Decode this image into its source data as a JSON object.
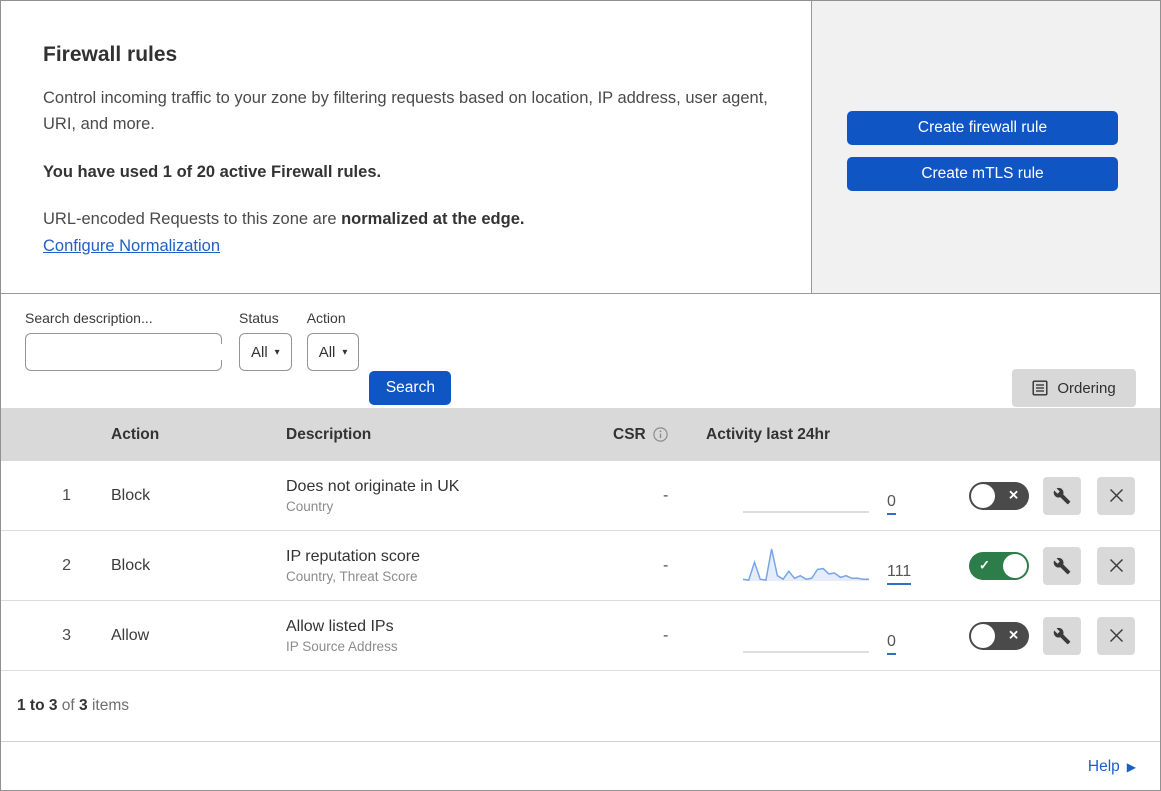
{
  "header": {
    "title": "Firewall rules",
    "description": "Control incoming traffic to your zone by filtering requests based on location, IP address, user agent, URI, and more.",
    "usage_note": "You have used 1 of 20 active Firewall rules.",
    "normalization_prefix": "URL-encoded Requests to this zone are ",
    "normalization_emphasis": "normalized at the edge.",
    "normalization_link": "Configure Normalization",
    "create_firewall_button": "Create firewall rule",
    "create_mtls_button": "Create mTLS rule"
  },
  "filters": {
    "search_label": "Search description...",
    "status": {
      "label": "Status",
      "value": "All"
    },
    "action": {
      "label": "Action",
      "value": "All"
    },
    "search_button": "Search",
    "ordering_button": "Ordering"
  },
  "table": {
    "headers": {
      "action": "Action",
      "description": "Description",
      "csr": "CSR",
      "activity": "Activity last 24hr"
    },
    "rows": [
      {
        "priority": "1",
        "action": "Block",
        "description": "Does not originate in UK",
        "parameters": "Country",
        "csr": "-",
        "activity_count": "0",
        "enabled": false,
        "sparkline": []
      },
      {
        "priority": "2",
        "action": "Block",
        "description": "IP reputation score",
        "parameters": "Country, Threat Score",
        "csr": "-",
        "activity_count": "111",
        "enabled": true,
        "sparkline": [
          2,
          1,
          21,
          2,
          1,
          36,
          6,
          2,
          11,
          3,
          6,
          2,
          3,
          13,
          14,
          8,
          9,
          4,
          6,
          3,
          3,
          2,
          2
        ]
      },
      {
        "priority": "3",
        "action": "Allow",
        "description": "Allow listed IPs",
        "parameters": "IP Source Address",
        "csr": "-",
        "activity_count": "0",
        "enabled": false,
        "sparkline": []
      }
    ]
  },
  "footer": {
    "range": "1 to 3",
    "of_word": " of ",
    "total": "3",
    "items_word": " items",
    "help": "Help"
  },
  "icons": {
    "caret": "▾",
    "help_arrow": "▶",
    "check_glyph": "✓",
    "x_glyph": "✕"
  },
  "colors": {
    "accent_blue": "#0f55c3",
    "link_blue": "#2160c4",
    "toggle_on_green": "#2c7d49",
    "toggle_off_gray": "#4a4a4a",
    "sparkline_line": "#7aa5e3",
    "sparkline_fill": "#e4edf9",
    "flatline_gray": "#c9c9c9",
    "table_header_bg": "#d9d9d9"
  }
}
